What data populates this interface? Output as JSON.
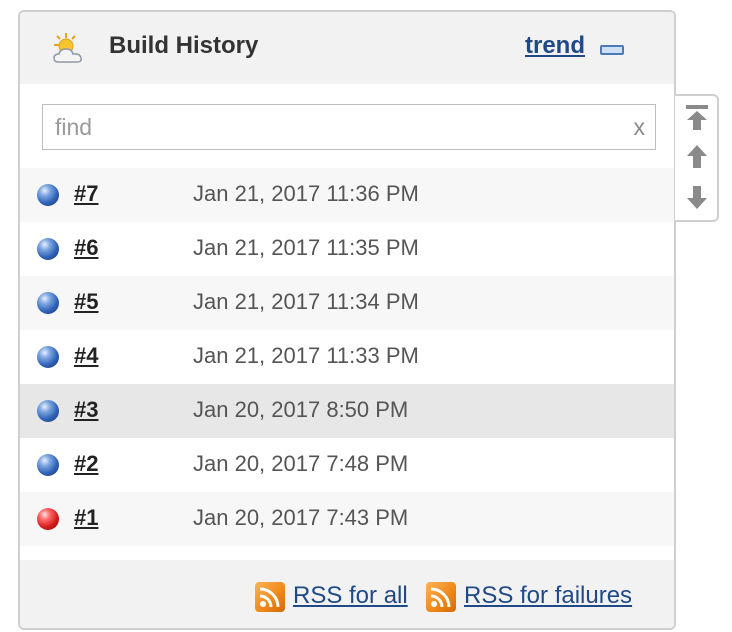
{
  "header": {
    "title": "Build History",
    "trend_label": "trend",
    "weather_icon": "weather-partly-cloudy-icon",
    "collapse_icon": "collapse-icon"
  },
  "search": {
    "placeholder": "find",
    "value": "",
    "clear_label": "x"
  },
  "builds": [
    {
      "number": "#7",
      "date": "Jan 21, 2017 11:36 PM",
      "status": "success",
      "status_color": "#2f62b8"
    },
    {
      "number": "#6",
      "date": "Jan 21, 2017 11:35 PM",
      "status": "success",
      "status_color": "#2f62b8"
    },
    {
      "number": "#5",
      "date": "Jan 21, 2017 11:34 PM",
      "status": "success",
      "status_color": "#2f62b8"
    },
    {
      "number": "#4",
      "date": "Jan 21, 2017 11:33 PM",
      "status": "success",
      "status_color": "#2f62b8"
    },
    {
      "number": "#3",
      "date": "Jan 20, 2017 8:50 PM",
      "status": "success",
      "status_color": "#2f62b8",
      "highlighted": true
    },
    {
      "number": "#2",
      "date": "Jan 20, 2017 7:48 PM",
      "status": "success",
      "status_color": "#2f62b8"
    },
    {
      "number": "#1",
      "date": "Jan 20, 2017 7:43 PM",
      "status": "failed",
      "status_color": "#d41c1c"
    }
  ],
  "footer": {
    "rss_all_label": "RSS for all",
    "rss_failures_label": "RSS for failures",
    "rss_icon": "rss-feed-icon"
  },
  "scroll_controls": {
    "icons": [
      "scroll-to-top-icon",
      "page-up-icon",
      "page-down-icon"
    ]
  },
  "colors": {
    "link": "#204a87",
    "header_bg": "#f2f2f2",
    "highlight_row": "#e7e7e7",
    "rss": "#f08a1a"
  }
}
